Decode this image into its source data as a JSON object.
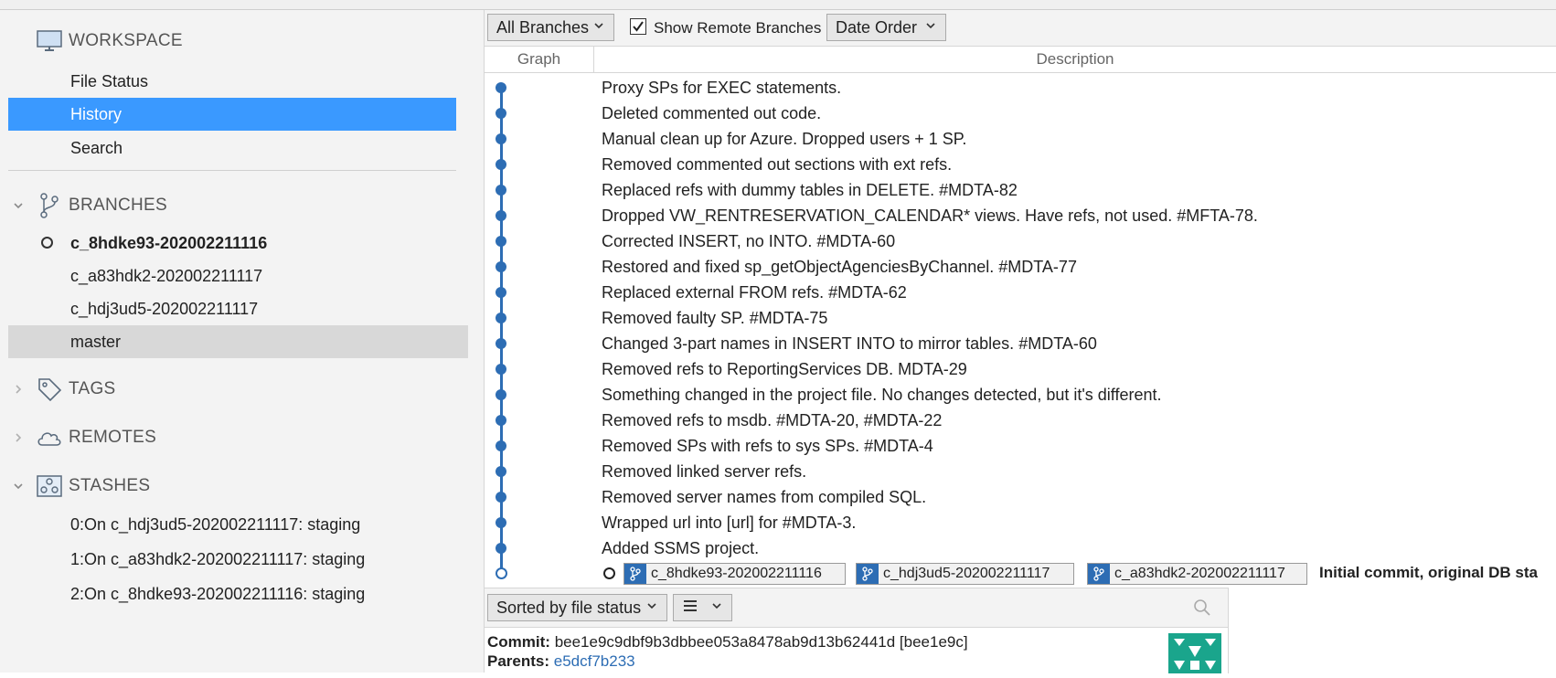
{
  "sidebar": {
    "workspace": {
      "title": "WORKSPACE",
      "items": [
        "File Status",
        "History",
        "Search"
      ]
    },
    "branches": {
      "title": "BRANCHES",
      "items": [
        "c_8hdke93-202002211116",
        "c_a83hdk2-202002211117",
        "c_hdj3ud5-202002211117",
        "master"
      ]
    },
    "tags": {
      "title": "TAGS"
    },
    "remotes": {
      "title": "REMOTES"
    },
    "stashes": {
      "title": "STASHES",
      "items": [
        "0:On c_hdj3ud5-202002211117: staging",
        "1:On c_a83hdk2-202002211117: staging",
        "2:On c_8hdke93-202002211116: staging"
      ]
    }
  },
  "toolbar": {
    "branches_filter": "All Branches",
    "show_remote_label": "Show Remote Branches",
    "show_remote_checked": true,
    "order": "Date Order"
  },
  "columns": {
    "graph": "Graph",
    "description": "Description"
  },
  "commits": [
    "Proxy SPs for EXEC statements.",
    "Deleted commented out code.",
    "Manual clean up for Azure. Dropped users + 1 SP.",
    "Removed commented out sections with ext refs.",
    "Replaced refs with dummy tables in DELETE. #MDTA-82",
    "Dropped VW_RENTRESERVATION_CALENDAR* views. Have refs, not used. #MFTA-78.",
    "Corrected INSERT, no INTO. #MDTA-60",
    "Restored and fixed sp_getObjectAgenciesByChannel. #MDTA-77",
    "Replaced external FROM refs. #MDTA-62",
    "Removed faulty SP. #MDTA-75",
    "Changed 3-part names in INSERT INTO to mirror tables. #MDTA-60",
    "Removed refs to ReportingServices DB. MDTA-29",
    "Something changed in the project file. No changes detected, but it's different.",
    "Removed refs to msdb. #MDTA-20, #MDTA-22",
    "Removed SPs with refs to sys SPs. #MDTA-4",
    "Removed linked server refs.",
    "Removed server names from compiled SQL.",
    "Wrapped url into [url] for #MDTA-3.",
    "Added SSMS project."
  ],
  "last_commit": {
    "branch_tags": [
      "c_8hdke93-202002211116",
      "c_hdj3ud5-202002211117",
      "c_a83hdk2-202002211117"
    ],
    "description": "Initial commit, original DB sta"
  },
  "file_pane": {
    "sort": "Sorted by file status",
    "commit_label": "Commit:",
    "commit_value": "bee1e9c9dbf9b3dbbee053a8478ab9d13b62441d [bee1e9c]",
    "parents_label": "Parents:",
    "parents_value": "e5dcf7b233"
  },
  "colors": {
    "accent": "#3a99ff",
    "graph": "#2d6db4",
    "avatar": "#1aa58c"
  }
}
